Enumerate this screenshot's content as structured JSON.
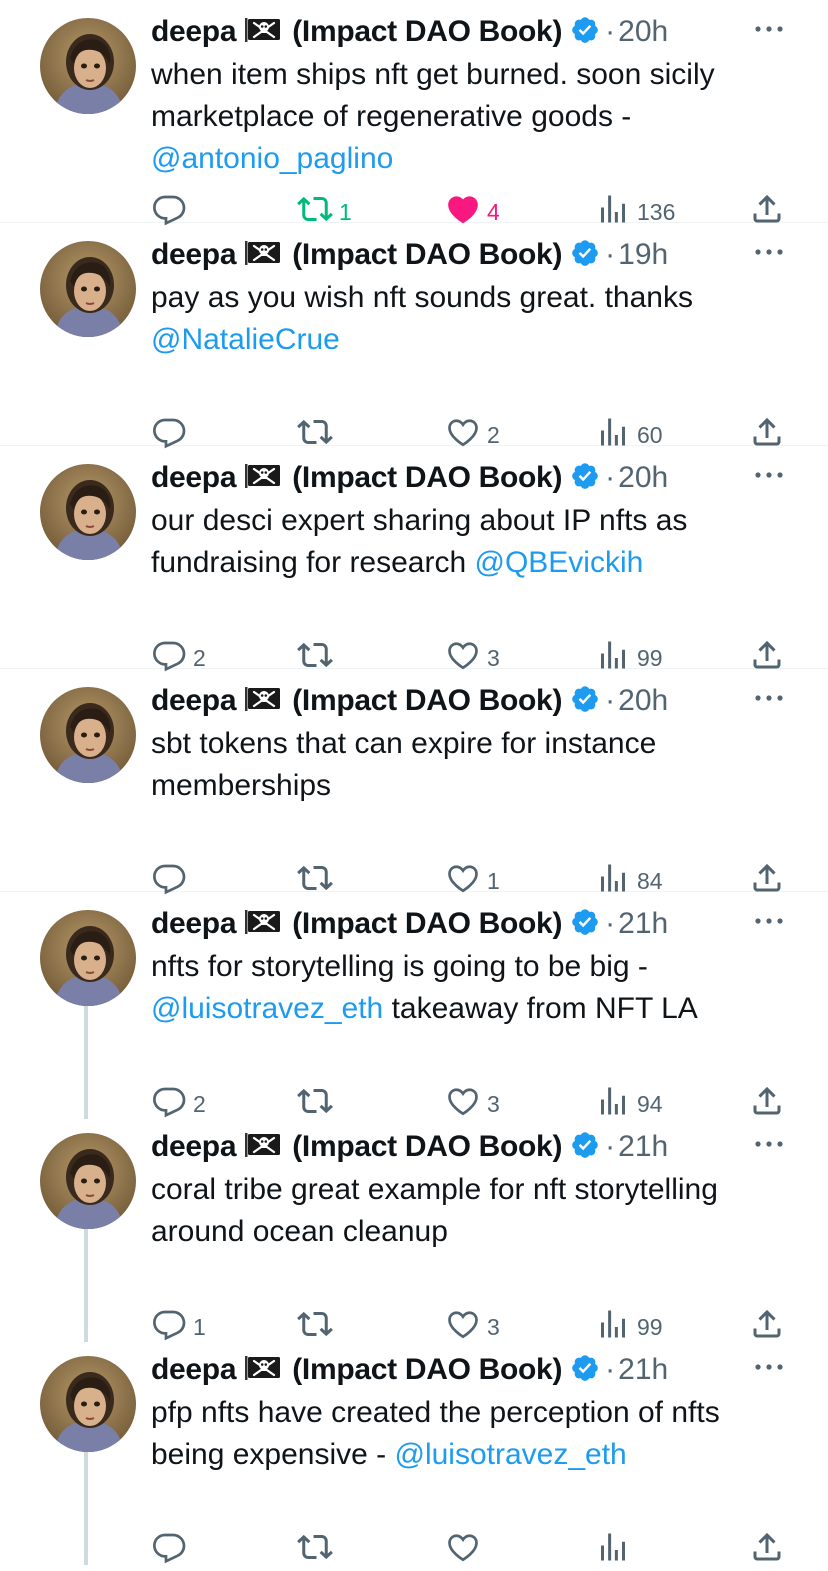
{
  "colors": {
    "accent": "#1d9bf0",
    "muted": "#536471",
    "retweet_on": "#00ba7c",
    "like_on": "#f91880",
    "thread_line": "#cfd9de"
  },
  "icons": {
    "reply": "reply-icon",
    "retweet": "retweet-icon",
    "like": "heart-icon",
    "views": "views-icon",
    "share": "share-icon",
    "more": "more-icon",
    "verified": "verified-icon",
    "flag": "pirate-flag-icon"
  },
  "tweets": [
    {
      "author": "deepa",
      "handle_suffix": "(Impact DAO Book)",
      "dot": "·",
      "time": "20h",
      "text_parts": [
        {
          "t": "when item ships nft get burned. soon sicily marketplace of regenerative goods - ",
          "m": false
        },
        {
          "t": "@antonio_paglino",
          "m": true
        }
      ],
      "replies": "",
      "retweets": "1",
      "likes": "4",
      "views": "136",
      "retweeted": true,
      "liked": true,
      "threaded": false
    },
    {
      "author": "deepa",
      "handle_suffix": "(Impact DAO Book)",
      "dot": "·",
      "time": "19h",
      "text_parts": [
        {
          "t": "pay as you wish nft sounds great. thanks ",
          "m": false
        },
        {
          "t": "@NatalieCrue",
          "m": true
        }
      ],
      "replies": "",
      "retweets": "",
      "likes": "2",
      "views": "60",
      "retweeted": false,
      "liked": false,
      "threaded": false
    },
    {
      "author": "deepa",
      "handle_suffix": "(Impact DAO Book)",
      "dot": "·",
      "time": "20h",
      "text_parts": [
        {
          "t": "our desci expert sharing about IP nfts as fundraising for research ",
          "m": false
        },
        {
          "t": "@QBEvickih",
          "m": true
        }
      ],
      "replies": "2",
      "retweets": "",
      "likes": "3",
      "views": "99",
      "retweeted": false,
      "liked": false,
      "threaded": false
    },
    {
      "author": "deepa",
      "handle_suffix": "(Impact DAO Book)",
      "dot": "·",
      "time": "20h",
      "text_parts": [
        {
          "t": "sbt tokens that can expire for instance memberships",
          "m": false
        }
      ],
      "replies": "",
      "retweets": "",
      "likes": "1",
      "views": "84",
      "retweeted": false,
      "liked": false,
      "threaded": false
    },
    {
      "author": "deepa",
      "handle_suffix": "(Impact DAO Book)",
      "dot": "·",
      "time": "21h",
      "text_parts": [
        {
          "t": "nfts for storytelling is going to be big - ",
          "m": false
        },
        {
          "t": "@luisotravez_eth",
          "m": true
        },
        {
          "t": " takeaway from NFT LA",
          "m": false
        }
      ],
      "replies": "2",
      "retweets": "",
      "likes": "3",
      "views": "94",
      "retweeted": false,
      "liked": false,
      "threaded": true
    },
    {
      "author": "deepa",
      "handle_suffix": "(Impact DAO Book)",
      "dot": "·",
      "time": "21h",
      "text_parts": [
        {
          "t": "coral tribe great example for nft storytelling around ocean cleanup",
          "m": false
        }
      ],
      "replies": "1",
      "retweets": "",
      "likes": "3",
      "views": "99",
      "retweeted": false,
      "liked": false,
      "threaded": true
    },
    {
      "author": "deepa",
      "handle_suffix": "(Impact DAO Book)",
      "dot": "·",
      "time": "21h",
      "text_parts": [
        {
          "t": "pfp nfts have created the perception of nfts being expensive - ",
          "m": false
        },
        {
          "t": "@luisotravez_eth",
          "m": true
        }
      ],
      "replies": "",
      "retweets": "",
      "likes": "",
      "views": "",
      "retweeted": false,
      "liked": false,
      "threaded": true
    }
  ]
}
